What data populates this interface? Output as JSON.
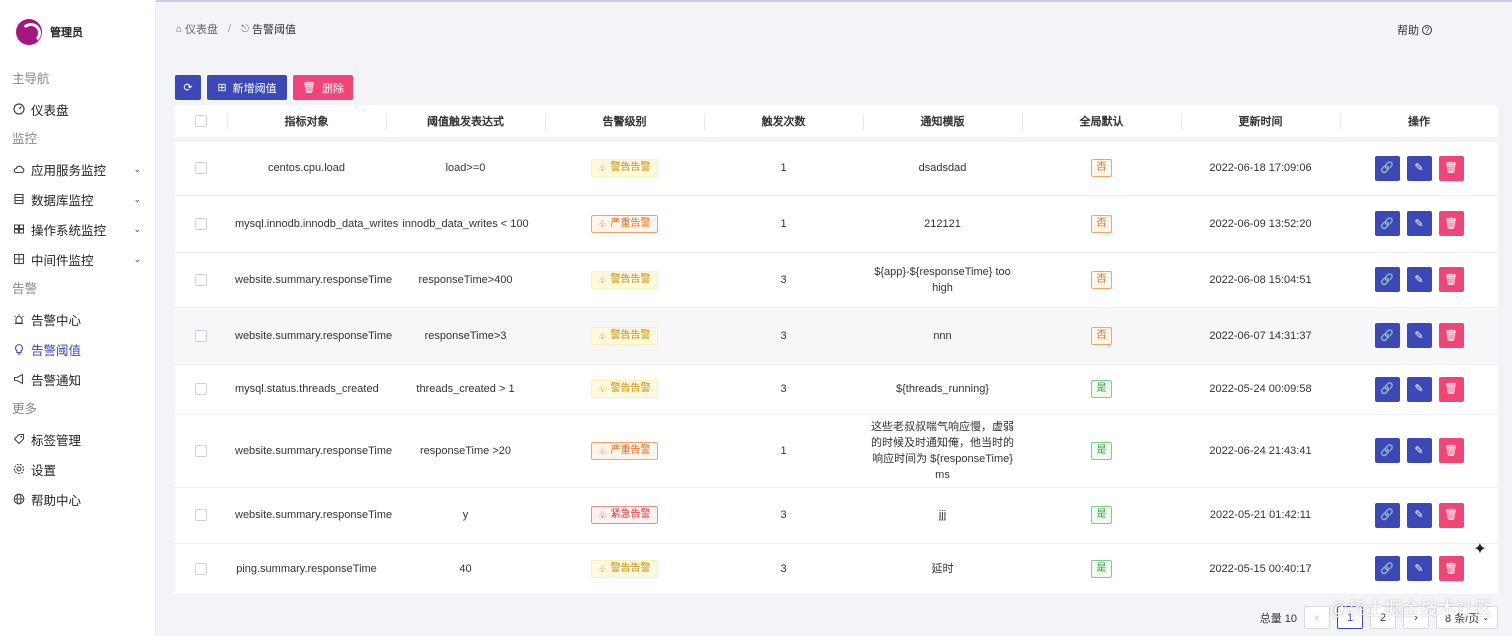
{
  "app": {
    "user_label": "管理员"
  },
  "sidebar": {
    "groups": {
      "main": "主导航",
      "monitor": "监控",
      "alert": "告警",
      "more": "更多"
    },
    "items": [
      {
        "label": "仪表盘",
        "icon": "dashboard-icon"
      },
      {
        "label": "应用服务监控",
        "icon": "cloud-icon"
      },
      {
        "label": "数据库监控",
        "icon": "database-icon"
      },
      {
        "label": "操作系统监控",
        "icon": "windows-icon"
      },
      {
        "label": "中间件监控",
        "icon": "grid-icon"
      },
      {
        "label": "告警中心",
        "icon": "alarm-icon"
      },
      {
        "label": "告警阈值",
        "icon": "bulb-icon"
      },
      {
        "label": "告警通知",
        "icon": "megaphone-icon"
      },
      {
        "label": "标签管理",
        "icon": "tag-icon"
      },
      {
        "label": "设置",
        "icon": "gear-icon"
      },
      {
        "label": "帮助中心",
        "icon": "globe-icon"
      }
    ]
  },
  "header": {
    "crumbs": [
      "仪表盘",
      "/",
      "告警阈值"
    ],
    "help": "帮助"
  },
  "toolbar": {
    "add_label": "新增阈值",
    "delete_label": "删除"
  },
  "table": {
    "columns": [
      "指标对象",
      "阈值触发表达式",
      "告警级别",
      "触发次数",
      "通知模版",
      "全局默认",
      "更新时间",
      "操作"
    ],
    "rows": [
      {
        "metric": "centos.cpu.load",
        "expr": "load>=0",
        "level": "警告告警",
        "count": "1",
        "template": "dsadsdad",
        "default": "否",
        "updated": "2022-06-18 17:09:06"
      },
      {
        "metric": "mysql.innodb.innodb_data_writes",
        "expr": "innodb_data_writes < 100",
        "level": "严重告警",
        "count": "1",
        "template": "212121",
        "default": "否",
        "updated": "2022-06-09 13:52:20"
      },
      {
        "metric": "website.summary.responseTime",
        "expr": "responseTime>400",
        "level": "警告告警",
        "count": "3",
        "template": "${app}-${responseTime} too high",
        "default": "否",
        "updated": "2022-06-08 15:04:51"
      },
      {
        "metric": "website.summary.responseTime",
        "expr": "responseTime>3",
        "level": "警告告警",
        "count": "3",
        "template": "nnn",
        "default": "否",
        "updated": "2022-06-07 14:31:37"
      },
      {
        "metric": "mysql.status.threads_created",
        "expr": "threads_created > 1",
        "level": "警告告警",
        "count": "3",
        "template": "${threads_running}",
        "default": "是",
        "updated": "2022-05-24 00:09:58"
      },
      {
        "metric": "website.summary.responseTime",
        "expr": "responseTime >20",
        "level": "严重告警",
        "count": "1",
        "template": "这些老叔叔喘气响应慢，虚弱的时候及时通知俺，他当时的响应时间为 ${responseTime} ms",
        "default": "是",
        "updated": "2022-06-24 21:43:41"
      },
      {
        "metric": "website.summary.responseTime",
        "expr": "y",
        "level": "紧急告警",
        "count": "3",
        "template": "jjj",
        "default": "是",
        "updated": "2022-05-21 01:42:11"
      },
      {
        "metric": "ping.summary.responseTime",
        "expr": "40",
        "level": "警告告警",
        "count": "3",
        "template": "延时",
        "default": "是",
        "updated": "2022-05-15 00:40:17"
      }
    ]
  },
  "pagination": {
    "total": "总量 10",
    "pages": [
      "1",
      "2"
    ],
    "page_size": "8 条/页"
  },
  "watermark": "@稀土掘金技术社区",
  "colors": {
    "primary": "#3b48b5",
    "danger": "#f1457a",
    "brand": "#a5157e"
  }
}
